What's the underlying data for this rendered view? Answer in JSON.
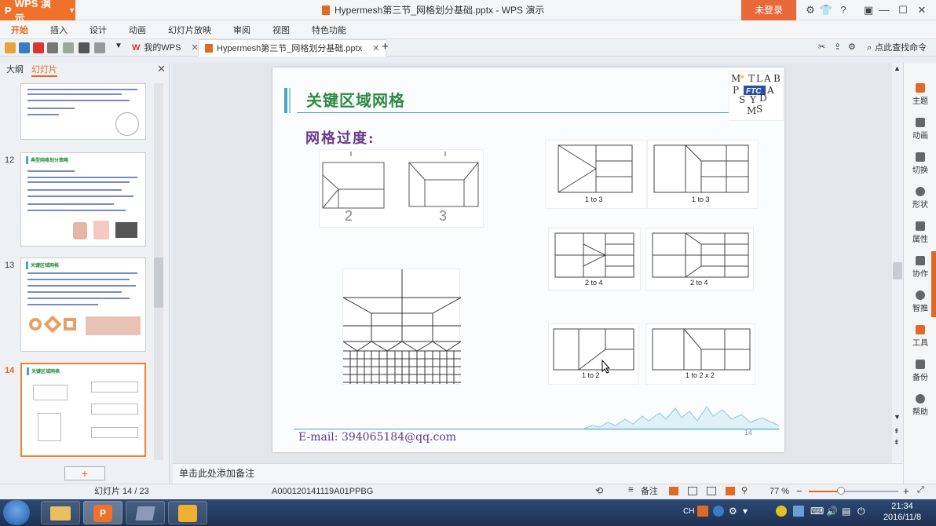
{
  "titlebar": {
    "app_button": "WPS 演示",
    "document_title": "Hypermesh第三节_网格划分基础.pptx - WPS 演示",
    "login_button": "未登录"
  },
  "menubar": {
    "items": [
      "开始",
      "插入",
      "设计",
      "动画",
      "幻灯片放映",
      "审阅",
      "视图",
      "特色功能"
    ]
  },
  "tabs": {
    "my_wps": "我的WPS",
    "document": "Hypermesh第三节_网格划分基础.pptx",
    "find_command": "点此查找命令"
  },
  "left_panel": {
    "tab_outline": "大纲",
    "tab_slides": "幻灯片",
    "slide_numbers": [
      "12",
      "13",
      "14"
    ],
    "thumb_titles": [
      "典型网格划分策略",
      "关键区域网格",
      "关键区域网格"
    ]
  },
  "slide": {
    "title": "关键区域网格",
    "subtitle": "网格过度:",
    "email": "E-mail: 394065184@qq.com",
    "page_number": "14",
    "hand_numbers": [
      "2",
      "3"
    ],
    "captions": [
      "1 to 3",
      "1 to 3",
      "2 to 4",
      "2 to 4",
      "1 to 2",
      "1 to 2 x 2"
    ],
    "logo_letters": "MATLAB FTC SYMS"
  },
  "notes_placeholder": "单击此处添加备注",
  "right_tools": [
    "主题",
    "动画",
    "切换",
    "形状",
    "属性",
    "协作",
    "智推",
    "工具",
    "备份",
    "帮助"
  ],
  "statusbar": {
    "slide_indicator": "幻灯片 14 / 23",
    "template": "A000120141119A01PPBG",
    "notes_label": "备注",
    "zoom": "77 %"
  },
  "taskbar": {
    "ime": "CH",
    "time": "21:34",
    "date": "2016/11/8"
  }
}
